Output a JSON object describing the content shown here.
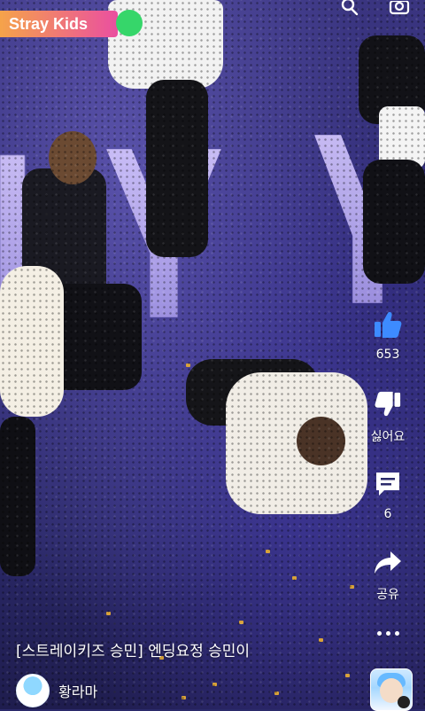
{
  "overlay": {
    "channel_badge": "Stray Kids",
    "colors": {
      "badge_start": "#f5a34a",
      "badge_end": "#ea4fa0",
      "live_dot": "#36d66a",
      "like_blue": "#3d8bff"
    },
    "top_icons": [
      "search-icon",
      "camera-icon"
    ]
  },
  "actions": {
    "like_count": "653",
    "dislike_label": "싫어요",
    "comment_count": "6",
    "share_label": "공유"
  },
  "video": {
    "title": "[스트레이키즈 승민] 엔딩요정 승민이",
    "author": "황라마"
  }
}
